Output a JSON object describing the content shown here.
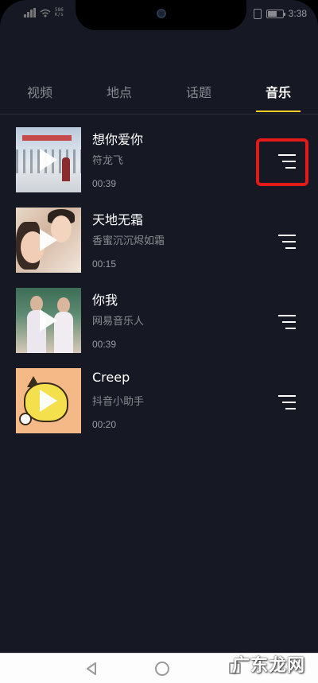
{
  "status_bar": {
    "net_speed_value": "586",
    "net_speed_unit": "K/s",
    "time": "3:38",
    "icons": [
      "signal-icon",
      "wifi-icon",
      "vibrate-icon",
      "battery-icon"
    ]
  },
  "tabs": [
    {
      "label": "视频",
      "active": false
    },
    {
      "label": "地点",
      "active": false
    },
    {
      "label": "话题",
      "active": false
    },
    {
      "label": "音乐",
      "active": true
    }
  ],
  "music_list": [
    {
      "title": "想你爱你",
      "author": "符龙飞",
      "duration": "00:39"
    },
    {
      "title": "天地无霜",
      "author": "香蜜沉沉烬如霜",
      "duration": "00:15"
    },
    {
      "title": "你我",
      "author": "网易音乐人",
      "duration": "00:39"
    },
    {
      "title": "Creep",
      "author": "抖音小助手",
      "duration": "00:20"
    }
  ],
  "watermark": "广东龙网",
  "colors": {
    "background": "#161823",
    "accent": "#facd28",
    "highlight": "#e21a1a"
  }
}
